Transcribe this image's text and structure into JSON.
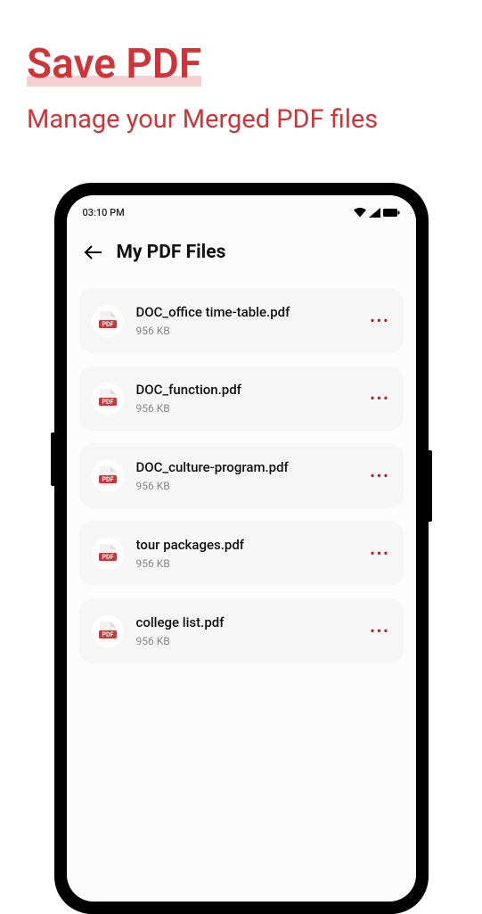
{
  "heading": {
    "title": "Save PDF",
    "subtitle": "Manage your Merged PDF files"
  },
  "statusbar": {
    "time": "03:10 PM"
  },
  "screen": {
    "title": "My PDF Files"
  },
  "files": [
    {
      "name": "DOC_office time-table.pdf",
      "size": "956 KB"
    },
    {
      "name": "DOC_function.pdf",
      "size": "956 KB"
    },
    {
      "name": "DOC_culture-program.pdf",
      "size": "956 KB"
    },
    {
      "name": "tour packages.pdf",
      "size": "956 KB"
    },
    {
      "name": "college list.pdf",
      "size": "956 KB"
    }
  ],
  "icons": {
    "pdf_label": "PDF"
  }
}
